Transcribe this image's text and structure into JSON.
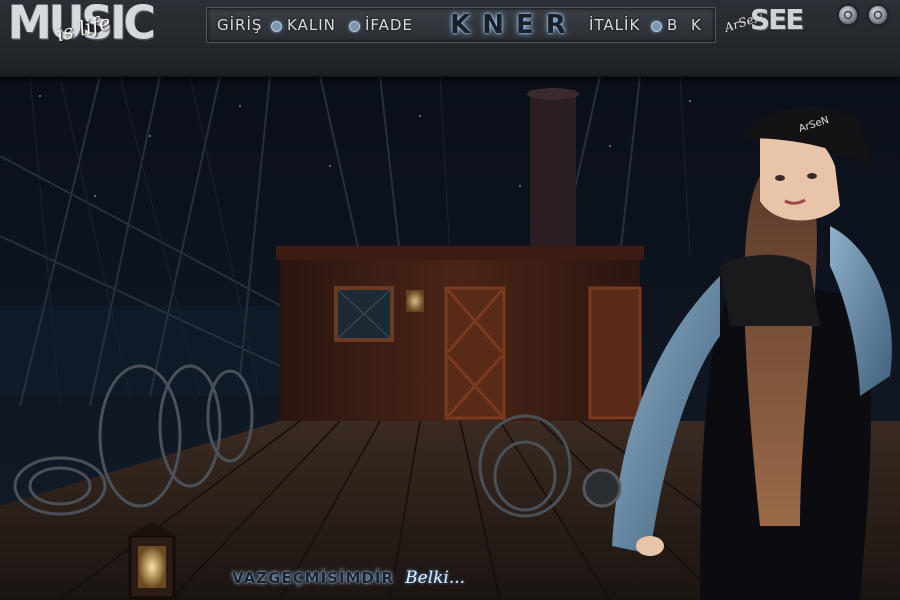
{
  "logo": {
    "main_text": "MUSIC",
    "script_text": "is life"
  },
  "nav": {
    "items": [
      {
        "label": "GİRİŞ"
      },
      {
        "label": "KALIN"
      },
      {
        "label": "İFADE"
      },
      {
        "label": "İTALİK"
      },
      {
        "label": "B"
      },
      {
        "label": "K"
      }
    ],
    "center_name": "KNER"
  },
  "artist_signature": {
    "script_text": "ArSeN",
    "block_text": "SEE"
  },
  "window_controls": {
    "count": 2
  },
  "caption": {
    "main": "VAZGEÇMİSİMDİR",
    "script": "Belki..."
  },
  "cap_text": "ArSeN",
  "colors": {
    "bar": "#2a2e33",
    "accent_glow": "#9bc6ff",
    "scene_bg": "#0b0f16",
    "wood": "#4a2416"
  }
}
